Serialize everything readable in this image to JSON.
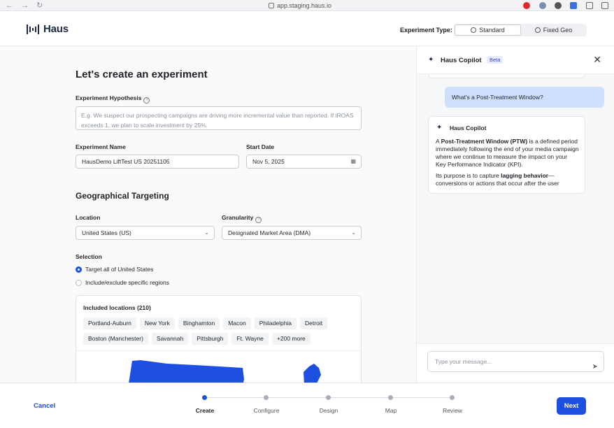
{
  "browser": {
    "url": "app.staging.haus.io"
  },
  "header": {
    "logo_text": "Haus",
    "experiment_type_label": "Experiment Type:",
    "experiment_type_options": [
      {
        "label": "Standard",
        "icon": "globe-icon",
        "selected": true
      },
      {
        "label": "Fixed Geo",
        "icon": "target-icon",
        "selected": false
      }
    ]
  },
  "form": {
    "title": "Let's create an experiment",
    "hypothesis": {
      "label": "Experiment Hypothesis",
      "placeholder": "E.g. We suspect our prospecting campaigns are driving more incremental value than reported. If iROAS exceeds 1, we plan to scale investment by 25%."
    },
    "experiment_name": {
      "label": "Experiment Name",
      "value": "HausDemo LiftTest US 20251105"
    },
    "start_date": {
      "label": "Start Date",
      "value": "Nov 5, 2025"
    },
    "geo": {
      "title": "Geographical Targeting",
      "location": {
        "label": "Location",
        "value": "United States (US)"
      },
      "granularity": {
        "label": "Granularity",
        "value": "Designated Market Area (DMA)"
      },
      "selection": {
        "label": "Selection",
        "options": [
          {
            "label": "Target all of United States",
            "checked": true
          },
          {
            "label": "Include/exclude specific regions",
            "checked": false
          }
        ]
      },
      "included": {
        "title": "Included locations (210)",
        "chips": [
          "Portland-Auburn",
          "New York",
          "Binghamton",
          "Macon",
          "Philadelphia",
          "Detroit",
          "Boston (Manchester)",
          "Savannah",
          "Pittsburgh",
          "Ft. Wayne",
          "+200 more"
        ]
      },
      "map_color": "#1d4fe0"
    }
  },
  "copilot": {
    "title": "Haus Copilot",
    "badge": "Beta",
    "user_message": "What's a Post-Treatment Window?",
    "bot_name": "Haus Copilot",
    "bot_p1_pre": "A ",
    "bot_p1_bold": "Post-Treatment Window (PTW)",
    "bot_p1_post": " is a defined period immediately following the end of your media campaign where we continue to measure the impact on your Key Performance Indicator (KPI).",
    "bot_p2_pre": "Its purpose is to capture ",
    "bot_p2_bold": "lagging behavior",
    "bot_p2_post": "— conversions or actions that occur after the user",
    "input_placeholder": "Type your message..."
  },
  "footer": {
    "cancel_label": "Cancel",
    "next_label": "Next",
    "steps": [
      {
        "label": "Create",
        "active": true
      },
      {
        "label": "Configure",
        "active": false
      },
      {
        "label": "Design",
        "active": false
      },
      {
        "label": "Map",
        "active": false
      },
      {
        "label": "Review",
        "active": false
      }
    ]
  },
  "colors": {
    "accent": "#1d4fe0",
    "user_bubble": "#cfe0ff"
  }
}
